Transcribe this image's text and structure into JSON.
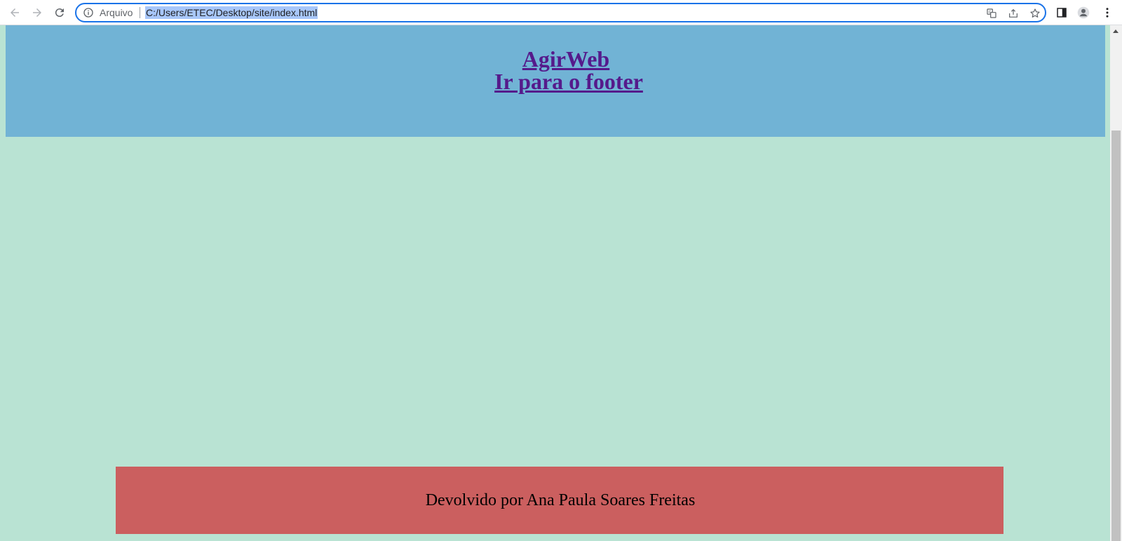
{
  "browser": {
    "scheme_label": "Arquivo",
    "url": "C:/Users/ETEC/Desktop/site/index.html",
    "icons": [
      "back-icon",
      "forward-icon",
      "reload-icon",
      "info-icon",
      "translate-icon",
      "share-icon",
      "star-icon",
      "side-panel-icon",
      "profile-icon",
      "menu-icon"
    ]
  },
  "header": {
    "link1": "AgirWeb",
    "link2": "Ir para o footer"
  },
  "footer": {
    "text": "Devolvido por Ana Paula Soares Freitas"
  },
  "colors": {
    "page_bg": "#b9e3d3",
    "header_bg": "#71b3d5",
    "footer_bg": "#cb5f5f",
    "link": "#551a8b"
  }
}
